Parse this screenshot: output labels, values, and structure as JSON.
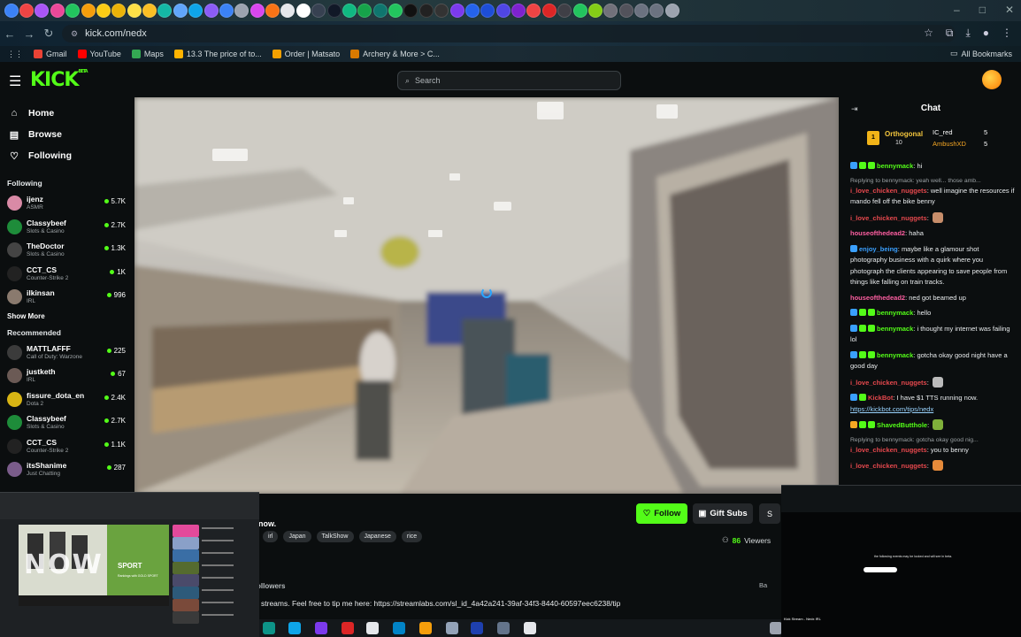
{
  "browser": {
    "url": "kick.com/nedx",
    "bookmarks": [
      "Gmail",
      "YouTube",
      "Maps",
      "13.3 The price of to...",
      "Order | Matsato",
      "Archery & More > C..."
    ],
    "all_bookmarks": "All Bookmarks",
    "bookmark_colors": [
      "#ea4335",
      "#ff0000",
      "#34a853",
      "#ffb300",
      "#f4a000",
      "#d97a00"
    ]
  },
  "header": {
    "logo": "KICK",
    "logo_sup": "BETA",
    "search_placeholder": "Search"
  },
  "sidebar": {
    "nav": [
      {
        "label": "Home",
        "icon": "home-icon"
      },
      {
        "label": "Browse",
        "icon": "browse-icon"
      },
      {
        "label": "Following",
        "icon": "heart-icon"
      }
    ],
    "following_title": "Following",
    "following": [
      {
        "name": "ijenz",
        "category": "ASMR",
        "viewers": "5.7K",
        "color": "#d98aa6"
      },
      {
        "name": "Classybeef",
        "category": "Slots & Casino",
        "viewers": "2.7K",
        "color": "#1e8c3a"
      },
      {
        "name": "TheDoctor",
        "category": "Slots & Casino",
        "viewers": "1.3K",
        "color": "#444"
      },
      {
        "name": "CCT_CS",
        "category": "Counter-Strike 2",
        "viewers": "1K",
        "color": "#222"
      },
      {
        "name": "ilkinsan",
        "category": "IRL",
        "viewers": "996",
        "color": "#8a7a6e"
      }
    ],
    "show_more": "Show More",
    "recommended_title": "Recommended",
    "recommended": [
      {
        "name": "MATTLAFFF",
        "category": "Call of Duty: Warzone",
        "viewers": "225",
        "color": "#3b3b3b"
      },
      {
        "name": "justketh",
        "category": "IRL",
        "viewers": "67",
        "color": "#6b5a55"
      },
      {
        "name": "fissure_dota_en",
        "category": "Dota 2",
        "viewers": "2.4K",
        "color": "#d8b514"
      },
      {
        "name": "Classybeef",
        "category": "Slots & Casino",
        "viewers": "2.7K",
        "color": "#1e8c3a"
      },
      {
        "name": "CCT_CS",
        "category": "Counter-Strike 2",
        "viewers": "1.1K",
        "color": "#222"
      },
      {
        "name": "itsShanime",
        "category": "Just Chatting",
        "viewers": "287",
        "color": "#7a5c8a"
      }
    ]
  },
  "chat": {
    "title": "Chat",
    "pinned": {
      "top_name": "Orthogonal",
      "top_value": "10",
      "subs": [
        {
          "name": "IC_red",
          "count": "5"
        },
        {
          "name": "AmbushXD",
          "count": "5"
        }
      ]
    },
    "messages": [
      {
        "user": "bennymack",
        "color": "#53fc18",
        "text": "hi",
        "badges": [
          "#3aa0ff",
          "#53fc18",
          "#53fc18"
        ]
      },
      {
        "reply": "Replying to bennymack: yeah well... those amb...",
        "user": "i_love_chicken_nuggets",
        "color": "#e5484d",
        "text": "well imagine the resources if mando fell off the bike benny"
      },
      {
        "user": "i_love_chicken_nuggets",
        "color": "#e5484d",
        "text": "",
        "emote": "#c78d6a"
      },
      {
        "user": "houseofthedead2",
        "color": "#ff5fa2",
        "text": "haha"
      },
      {
        "user": "enjoy_being",
        "color": "#3aa0ff",
        "text": "maybe like a glamour shot photography business with a quirk where you photograph the clients appearing to save people from things like falling on train tracks.",
        "badges": [
          "#3aa0ff"
        ]
      },
      {
        "user": "houseofthedead2",
        "color": "#ff5fa2",
        "text": "ned got beamed up"
      },
      {
        "user": "bennymack",
        "color": "#53fc18",
        "text": "hello",
        "badges": [
          "#3aa0ff",
          "#53fc18",
          "#53fc18"
        ]
      },
      {
        "user": "bennymack",
        "color": "#53fc18",
        "text": "i thought my internet was failing lol",
        "badges": [
          "#3aa0ff",
          "#53fc18",
          "#53fc18"
        ]
      },
      {
        "user": "bennymack",
        "color": "#53fc18",
        "text": "gotcha okay good night have a good day",
        "badges": [
          "#3aa0ff",
          "#53fc18",
          "#53fc18"
        ]
      },
      {
        "user": "i_love_chicken_nuggets",
        "color": "#e5484d",
        "text": "",
        "emote": "#bbbbbb"
      },
      {
        "user": "KickBot",
        "color": "#e5484d",
        "text": "I have $1 TTS running now.",
        "link": "https://kickbot.com/tips/nedx",
        "badges": [
          "#3aa0ff",
          "#53fc18"
        ]
      },
      {
        "user": "ShavedButthole",
        "color": "#53fc18",
        "text": "",
        "emote": "#7fb03a",
        "badges": [
          "#f5a623",
          "#53fc18",
          "#53fc18"
        ]
      },
      {
        "reply": "Replying to bennymack: gotcha okay good nig...",
        "user": "i_love_chicken_nuggets",
        "color": "#e5484d",
        "text": "you to benny"
      },
      {
        "user": "i_love_chicken_nuggets",
        "color": "#e5484d",
        "text": "",
        "emote": "#e58a3a"
      }
    ]
  },
  "stream": {
    "title_fragment": "now.",
    "tags": [
      "irl",
      "Japan",
      "TalkShow",
      "Japanese",
      "rice"
    ],
    "follow_label": "Follow",
    "gift_label": "Gift Subs",
    "share_label": "S",
    "viewers_count": "86",
    "viewers_label": "Viewers",
    "followers_fragment": "ollowers",
    "ba_fragment": "Ba",
    "about_fragment": "streams. Feel free to tip me here: https://streamlabs.com/sl_id_4a42a241-39af-34f3-8440-60597eec6238/tip"
  },
  "previews": {
    "left_now": "NOW",
    "left_sport": "SPORT",
    "left_sub": "Rankings with GOLD SPORT",
    "right_dialog": "the following events may be locked and will see in beta.",
    "right_caption": "Kick Stream - Nedx IRL"
  }
}
